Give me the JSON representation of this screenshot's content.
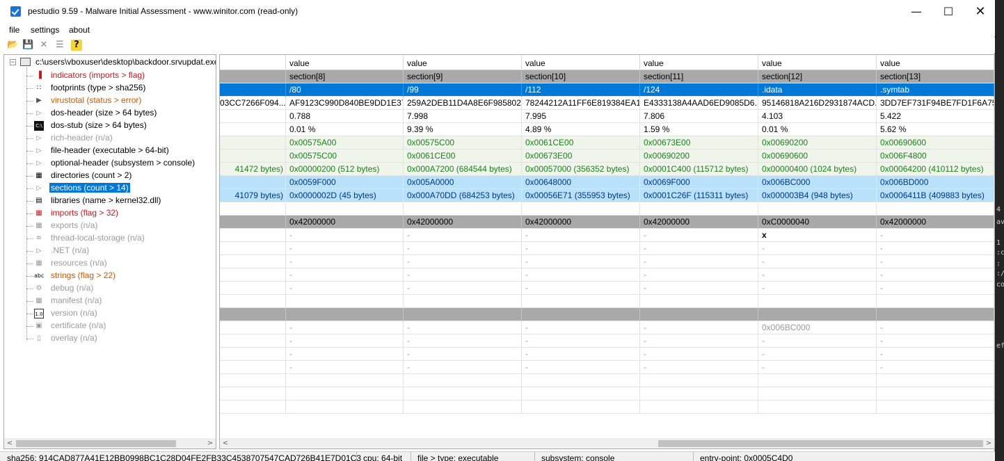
{
  "window": {
    "title": "pestudio 9.59 - Malware Initial Assessment - www.winitor.com (read-only)"
  },
  "menu": [
    "file",
    "settings",
    "about"
  ],
  "tree": {
    "root": "c:\\users\\vboxuser\\desktop\\backdoor.srvupdat.exe",
    "items": [
      {
        "label": "indicators (imports > flag)",
        "icon": "bars-icon",
        "color": "red"
      },
      {
        "label": "footprints (type > sha256)",
        "icon": "footprint-icon",
        "color": "black"
      },
      {
        "label": "virustotal (status > error)",
        "icon": "virustotal-icon",
        "color": "orange"
      },
      {
        "label": "dos-header (size > 64 bytes)",
        "icon": "arrow-icon",
        "color": "black"
      },
      {
        "label": "dos-stub (size > 64 bytes)",
        "icon": "console-icon",
        "color": "black"
      },
      {
        "label": "rich-header (n/a)",
        "icon": "arrow-icon",
        "color": "gray"
      },
      {
        "label": "file-header (executable > 64-bit)",
        "icon": "arrow-icon",
        "color": "black"
      },
      {
        "label": "optional-header (subsystem > console)",
        "icon": "arrow-icon",
        "color": "black"
      },
      {
        "label": "directories (count > 2)",
        "icon": "grid-icon",
        "color": "black"
      },
      {
        "label": "sections (count > 14)",
        "icon": "arrow-icon",
        "color": "black",
        "selected": true
      },
      {
        "label": "libraries (name > kernel32.dll)",
        "icon": "library-icon",
        "color": "black"
      },
      {
        "label": "imports (flag > 32)",
        "icon": "grid-icon",
        "color": "red"
      },
      {
        "label": "exports (n/a)",
        "icon": "grid-icon",
        "color": "gray"
      },
      {
        "label": "thread-local-storage (n/a)",
        "icon": "thread-icon",
        "color": "gray"
      },
      {
        "label": ".NET (n/a)",
        "icon": "arrow-icon",
        "color": "gray"
      },
      {
        "label": "resources (n/a)",
        "icon": "grid-icon",
        "color": "gray"
      },
      {
        "label": "strings (flag > 22)",
        "icon": "abc-icon",
        "color": "orange"
      },
      {
        "label": "debug (n/a)",
        "icon": "bug-icon",
        "color": "gray"
      },
      {
        "label": "manifest (n/a)",
        "icon": "grid-icon",
        "color": "gray"
      },
      {
        "label": "version (n/a)",
        "icon": "version-icon",
        "color": "gray"
      },
      {
        "label": "certificate (n/a)",
        "icon": "certificate-icon",
        "color": "gray"
      },
      {
        "label": "overlay (n/a)",
        "icon": "page-icon",
        "color": "gray"
      }
    ]
  },
  "grid": {
    "headers": [
      "",
      "value",
      "value",
      "value",
      "value",
      "value",
      "value"
    ],
    "rows": [
      {
        "style": "gray",
        "cells": [
          "",
          "section[8]",
          "section[9]",
          "section[10]",
          "section[11]",
          "section[12]",
          "section[13]"
        ]
      },
      {
        "style": "blue",
        "cells": [
          "",
          "/80",
          "/99",
          "/112",
          "/124",
          ".idata",
          ".symtab"
        ]
      },
      {
        "style": "plain",
        "cells": [
          "03CC7266F094...",
          "AF9123C990D840BE9DD1E37...",
          "259A2DEB11D4A8E6F985802...",
          "78244212A11FF6E819384EA1...",
          "E4333138A4AAD6ED9085D6...",
          "95146818A216D2931874ACD...",
          "3DD7EF731F94BE7FD1F6A75..."
        ]
      },
      {
        "style": "plain",
        "cells": [
          "",
          "0.788",
          "7.998",
          "7.995",
          "7.806",
          "4.103",
          "5.422"
        ]
      },
      {
        "style": "plain",
        "cells": [
          "",
          "0.01 %",
          "9.39 %",
          "4.89 %",
          "1.59 %",
          "0.01 %",
          "5.62 %"
        ]
      },
      {
        "style": "green",
        "cells": [
          "",
          "0x00575A00",
          "0x00575C00",
          "0x0061CE00",
          "0x00673E00",
          "0x00690200",
          "0x00690600"
        ]
      },
      {
        "style": "green",
        "cells": [
          "",
          "0x00575C00",
          "0x0061CE00",
          "0x00673E00",
          "0x00690200",
          "0x00690600",
          "0x006F4800"
        ]
      },
      {
        "style": "green",
        "cells": [
          "41472 bytes)",
          "0x00000200 (512 bytes)",
          "0x000A7200 (684544 bytes)",
          "0x00057000 (356352 bytes)",
          "0x0001C400 (115712 bytes)",
          "0x00000400 (1024 bytes)",
          "0x00064200 (410112 bytes)"
        ]
      },
      {
        "style": "lightblue",
        "cells": [
          "",
          "0x0059F000",
          "0x005A0000",
          "0x00648000",
          "0x0069F000",
          "0x006BC000",
          "0x006BD000"
        ]
      },
      {
        "style": "lightblue",
        "cells": [
          "41079 bytes)",
          "0x0000002D (45 bytes)",
          "0x000A70DD (684253 bytes)",
          "0x00056E71 (355953 bytes)",
          "0x0001C26F (115311 bytes)",
          "0x000003B4 (948 bytes)",
          "0x0006411B (409883 bytes)"
        ]
      },
      {
        "style": "plain",
        "cells": [
          "",
          "",
          "",
          "",
          "",
          "",
          ""
        ]
      },
      {
        "style": "gray",
        "cells": [
          "",
          "0x42000000",
          "0x42000000",
          "0x42000000",
          "0x42000000",
          "0xC0000040",
          "0x42000000"
        ]
      },
      {
        "style": "dim",
        "cells": [
          "",
          "-",
          "-",
          "-",
          "-",
          "x",
          "-"
        ]
      },
      {
        "style": "dim",
        "cells": [
          "",
          "-",
          "-",
          "-",
          "-",
          "-",
          "-"
        ]
      },
      {
        "style": "dim",
        "cells": [
          "",
          "-",
          "-",
          "-",
          "-",
          "-",
          "-"
        ]
      },
      {
        "style": "dim",
        "cells": [
          "",
          "-",
          "-",
          "-",
          "-",
          "-",
          "-"
        ]
      },
      {
        "style": "dim",
        "cells": [
          "",
          "-",
          "-",
          "-",
          "-",
          "-",
          "-"
        ]
      },
      {
        "style": "plain",
        "cells": [
          "",
          "",
          "",
          "",
          "",
          "",
          ""
        ]
      },
      {
        "style": "gray",
        "cells": [
          "",
          "",
          "",
          "",
          "",
          "",
          ""
        ]
      },
      {
        "style": "dim",
        "cells": [
          "",
          "-",
          "-",
          "-",
          "-",
          "0x006BC000",
          "-"
        ]
      },
      {
        "style": "dim",
        "cells": [
          "",
          "-",
          "-",
          "-",
          "-",
          "-",
          "-"
        ]
      },
      {
        "style": "dim",
        "cells": [
          "",
          "-",
          "-",
          "-",
          "-",
          "-",
          "-"
        ]
      },
      {
        "style": "dim",
        "cells": [
          "",
          "-",
          "-",
          "-",
          "-",
          "-",
          "-"
        ]
      },
      {
        "style": "plain",
        "cells": [
          "",
          "",
          "",
          "",
          "",
          "",
          ""
        ]
      },
      {
        "style": "plain",
        "cells": [
          "",
          "",
          "",
          "",
          "",
          "",
          ""
        ]
      },
      {
        "style": "plain",
        "cells": [
          "",
          "",
          "",
          "",
          "",
          "",
          ""
        ]
      }
    ]
  },
  "status": {
    "sha256": "sha256: 914CAD877A41E12BB0998BC1C28D04FE2FB33C4538707547CAD726B41E7D01C3",
    "cpu": "cpu: 64-bit",
    "filetype": "file > type: executable",
    "subsystem": "subsystem: console",
    "entrypoint": "entry-point: 0x0005C4D0"
  },
  "background_fragments": [
    "4",
    "av",
    "1",
    ":c",
    ":",
    ":/",
    "co",
    "efa"
  ]
}
